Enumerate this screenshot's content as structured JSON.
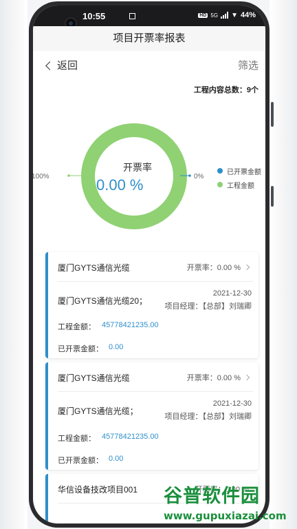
{
  "status_bar": {
    "time": "10:55",
    "network": "5G",
    "battery": "44%",
    "hd": "HD"
  },
  "app": {
    "title": "项目开票率报表"
  },
  "nav": {
    "back_label": "返回",
    "filter_label": "筛选"
  },
  "summary": {
    "total_label": "工程内容总数：9个"
  },
  "chart_data": {
    "type": "pie",
    "title": "开票率",
    "center_value": "0.00 %",
    "series": [
      {
        "name": "已开票金额",
        "value": 0,
        "label": "0%",
        "color": "#2f8fc9"
      },
      {
        "name": "工程金额",
        "value": 100,
        "label": "100%",
        "color": "#8fd173"
      }
    ],
    "legend_position": "right"
  },
  "cards": [
    {
      "title": "厦门GYTS通信光缆",
      "rate_label": "开票率：0.00 %",
      "sub_title": "厦门GYTS通信光缆20；",
      "date": "2021-12-30",
      "manager": "项目经理：【总部】刘瑞卿",
      "amount_label": "工程金额：",
      "amount_value": "45778421235.00",
      "invoiced_label": "已开票金额：",
      "invoiced_value": "0.00"
    },
    {
      "title": "厦门GYTS通信光缆",
      "rate_label": "开票率：0.00 %",
      "sub_title": "厦门GYTS通信光缆；",
      "date": "2021-12-30",
      "manager": "项目经理：【总部】刘瑞卿",
      "amount_label": "工程金额：",
      "amount_value": "45778421235.00",
      "invoiced_label": "已开票金额：",
      "invoiced_value": "0.00"
    },
    {
      "title": "华信设备技改项目001",
      "rate_label": "开票率：0.00 %"
    }
  ],
  "watermark": {
    "brand": "谷普软件园",
    "url": "www.gupuxiazai.com"
  },
  "colors": {
    "accent": "#2f8fc9",
    "ring": "#8fd173",
    "watermark": "#1a8f3c"
  }
}
